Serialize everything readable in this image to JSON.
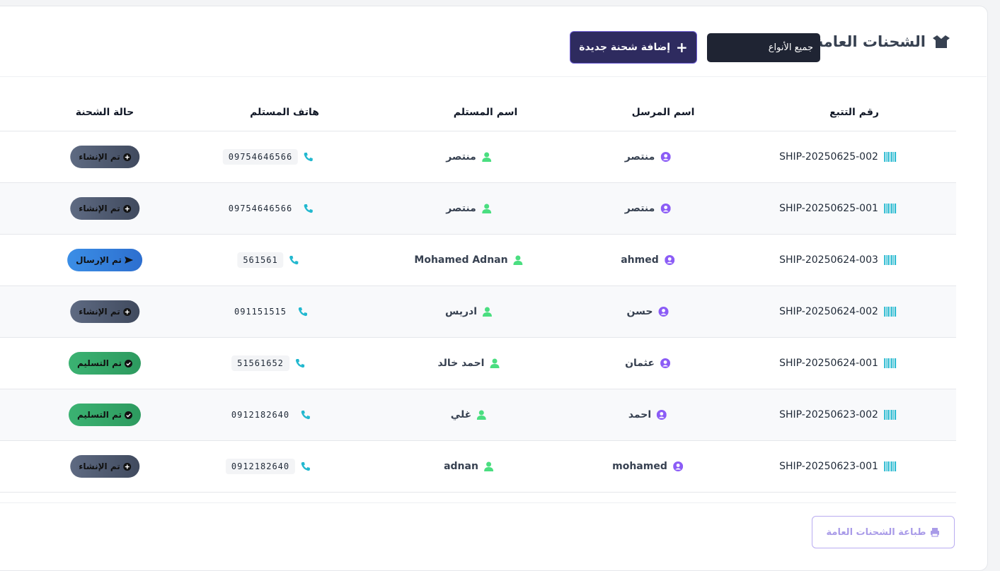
{
  "header": {
    "title": "الشحنات العامة",
    "type_filter": "جميع الأنواع",
    "add_button": "إضافة شحنة جديدة"
  },
  "table": {
    "columns": [
      "رقم التتبع",
      "اسم المرسل",
      "اسم المستلم",
      "هاتف المستلم",
      "حالة الشحنة"
    ],
    "rows": [
      {
        "tracking": "SHIP-20250625-002",
        "sender": "منتصر",
        "receiver": "منتصر",
        "phone": "09754646566",
        "status": "تم الإنشاء",
        "status_type": "created"
      },
      {
        "tracking": "SHIP-20250625-001",
        "sender": "منتصر",
        "receiver": "منتصر",
        "phone": "09754646566",
        "status": "تم الإنشاء",
        "status_type": "created"
      },
      {
        "tracking": "SHIP-20250624-003",
        "sender": "ahmed",
        "receiver": "Mohamed Adnan",
        "phone": "561561",
        "status": "تم الإرسال",
        "status_type": "sent"
      },
      {
        "tracking": "SHIP-20250624-002",
        "sender": "حسن",
        "receiver": "ادريس",
        "phone": "091151515",
        "status": "تم الإنشاء",
        "status_type": "created"
      },
      {
        "tracking": "SHIP-20250624-001",
        "sender": "عثمان",
        "receiver": "احمد خالد",
        "phone": "51561652",
        "status": "تم التسليم",
        "status_type": "delivered"
      },
      {
        "tracking": "SHIP-20250623-002",
        "sender": "احمد",
        "receiver": "غلي",
        "phone": "0912182640",
        "status": "تم التسليم",
        "status_type": "delivered"
      },
      {
        "tracking": "SHIP-20250623-001",
        "sender": "mohamed",
        "receiver": "adnan",
        "phone": "0912182640",
        "status": "تم الإنشاء",
        "status_type": "created"
      }
    ]
  },
  "footer": {
    "print_button": "طباعة الشحنات العامة"
  },
  "colors": {
    "sender_icon": "#8b5cf6",
    "receiver_icon": "#4ade80",
    "phone_icon": "#22b8cf",
    "barcode_icon": "#22b8cf"
  }
}
